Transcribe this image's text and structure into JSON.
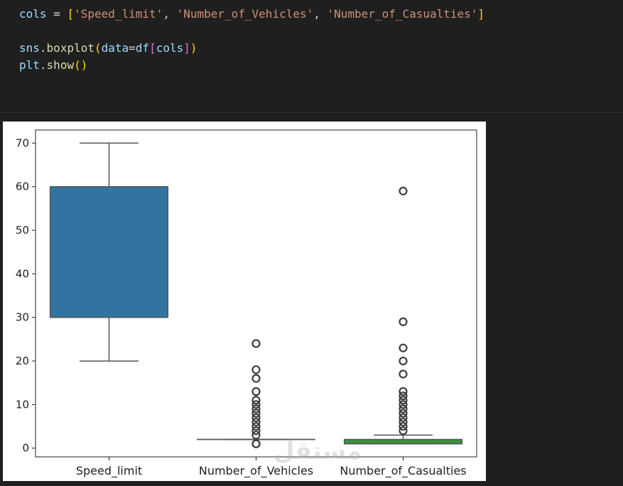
{
  "code": {
    "line1": {
      "var": "cols",
      "op": " = ",
      "open": "[",
      "s1": "'Speed_limit'",
      "c1": ", ",
      "s2": "'Number_of_Vehicles'",
      "c2": ", ",
      "s3": "'Number_of_Casualties'",
      "close": "]"
    },
    "line2": {
      "mod": "sns",
      "dot": ".",
      "fn": "boxplot",
      "open": "(",
      "arg": "data",
      "eq": "=",
      "df": "df",
      "lb": "[",
      "cols": "cols",
      "rb": "]",
      "close": ")"
    },
    "line3": {
      "mod": "plt",
      "dot": ".",
      "fn": "show",
      "paren": "()"
    }
  },
  "watermark": "مستقل",
  "colors": {
    "series": [
      "#3274a1",
      "#e1812c",
      "#3a923a"
    ],
    "whisker": "#555555"
  },
  "chart_data": {
    "type": "box",
    "title": "",
    "xlabel": "",
    "ylabel": "",
    "ylim": [
      -2,
      73
    ],
    "yticks": [
      0,
      10,
      20,
      30,
      40,
      50,
      60,
      70
    ],
    "categories": [
      "Speed_limit",
      "Number_of_Vehicles",
      "Number_of_Casualties"
    ],
    "boxes": [
      {
        "name": "Speed_limit",
        "min": 20,
        "q1": 30,
        "median": 30,
        "q3": 60,
        "max": 70,
        "outliers": []
      },
      {
        "name": "Number_of_Vehicles",
        "min": 2,
        "q1": 2,
        "median": 2,
        "q3": 2,
        "max": 2,
        "outliers": [
          1,
          1,
          3,
          4,
          5,
          6,
          7,
          8,
          9,
          10,
          11,
          13,
          16,
          18,
          24
        ]
      },
      {
        "name": "Number_of_Casualties",
        "min": 1,
        "q1": 1,
        "median": 1,
        "q3": 2,
        "max": 3,
        "outliers": [
          4,
          5,
          6,
          7,
          8,
          9,
          10,
          11,
          12,
          13,
          17,
          20,
          23,
          29,
          59
        ]
      }
    ]
  }
}
